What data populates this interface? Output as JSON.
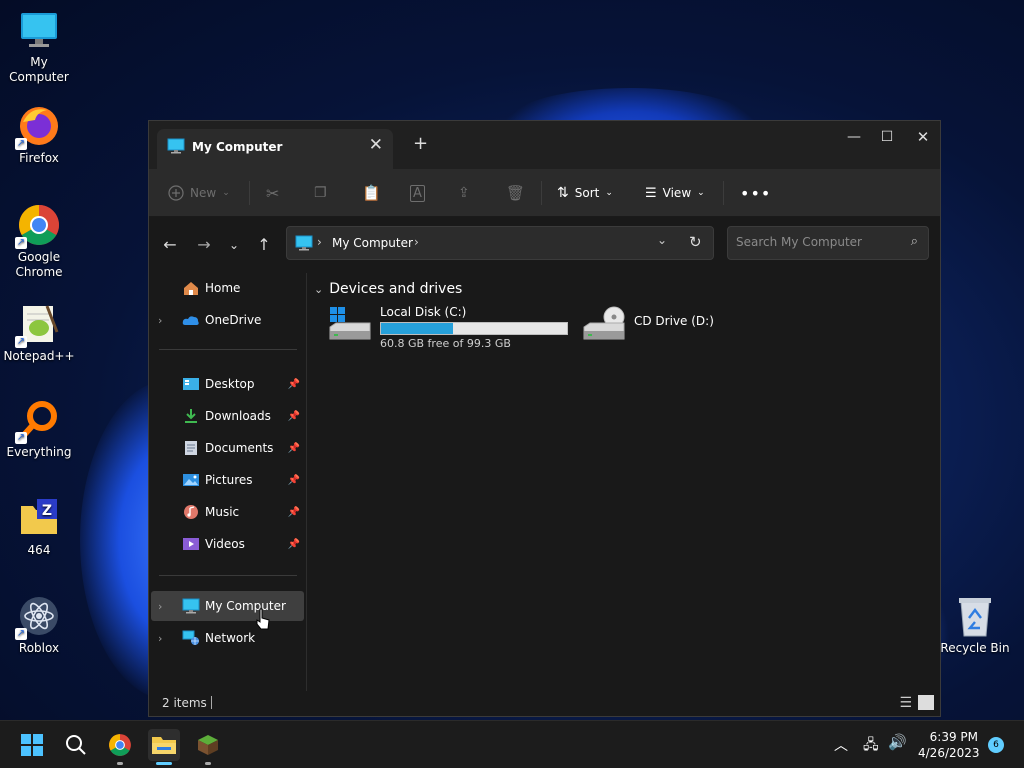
{
  "desktop": {
    "icons": [
      {
        "label": "My Computer"
      },
      {
        "label": "Firefox"
      },
      {
        "label": "Google Chrome"
      },
      {
        "label": "Notepad++"
      },
      {
        "label": "Everything"
      },
      {
        "label": "464"
      },
      {
        "label": "Roblox"
      },
      {
        "label": "Recycle Bin"
      }
    ]
  },
  "window": {
    "tab_title": "My Computer",
    "toolbar": {
      "new_label": "New",
      "sort_label": "Sort",
      "view_label": "View"
    },
    "address": {
      "crumb": "My Computer"
    },
    "search": {
      "placeholder": "Search My Computer"
    },
    "sidebar": {
      "items": [
        {
          "label": "Home"
        },
        {
          "label": "OneDrive"
        },
        {
          "label": "Desktop"
        },
        {
          "label": "Downloads"
        },
        {
          "label": "Documents"
        },
        {
          "label": "Pictures"
        },
        {
          "label": "Music"
        },
        {
          "label": "Videos"
        },
        {
          "label": "My Computer"
        },
        {
          "label": "Network"
        }
      ]
    },
    "content": {
      "group_header": "Devices and drives",
      "drives": [
        {
          "name": "Local Disk (C:)",
          "free_text": "60.8 GB free of 99.3 GB",
          "used_fraction": 0.388
        },
        {
          "name": "CD Drive (D:)"
        }
      ]
    },
    "status": {
      "item_count": "2 items"
    }
  },
  "taskbar": {
    "time": "6:39 PM",
    "date": "4/26/2023",
    "notification_count": "6"
  },
  "colors": {
    "accent": "#60cdff",
    "drive_bar": "#26a0da"
  }
}
